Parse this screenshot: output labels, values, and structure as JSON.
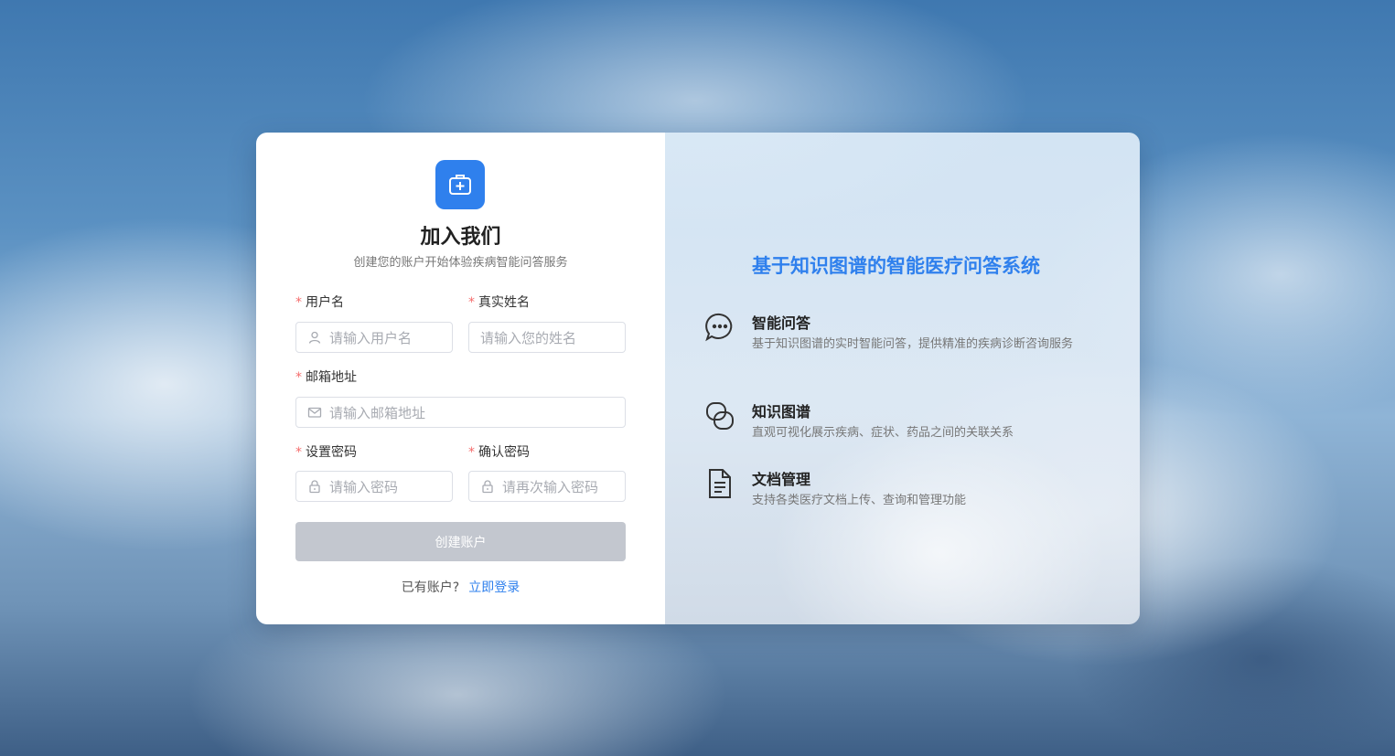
{
  "form": {
    "title": "加入我们",
    "subtitle": "创建您的账户开始体验疾病智能问答服务",
    "required_mark": "*",
    "username": {
      "label": "用户名",
      "placeholder": "请输入用户名"
    },
    "realname": {
      "label": "真实姓名",
      "placeholder": "请输入您的姓名"
    },
    "email": {
      "label": "邮箱地址",
      "placeholder": "请输入邮箱地址"
    },
    "password": {
      "label": "设置密码",
      "placeholder": "请输入密码"
    },
    "confirm": {
      "label": "确认密码",
      "placeholder": "请再次输入密码"
    },
    "submit_label": "创建账户",
    "has_account": "已有账户?",
    "login_link": "立即登录"
  },
  "info": {
    "title": "基于知识图谱的智能医疗问答系统",
    "features": [
      {
        "icon": "chat-bubble-icon",
        "title": "智能问答",
        "desc": "基于知识图谱的实时智能问答，提供精准的疾病诊断咨询服务"
      },
      {
        "icon": "link-icon",
        "title": "知识图谱",
        "desc": "直观可视化展示疾病、症状、药品之间的关联关系"
      },
      {
        "icon": "document-icon",
        "title": "文档管理",
        "desc": "支持各类医疗文档上传、查询和管理功能"
      }
    ]
  },
  "colors": {
    "accent": "#2f80ed",
    "button_disabled": "#c3c7cf",
    "required": "#f56c6c"
  }
}
